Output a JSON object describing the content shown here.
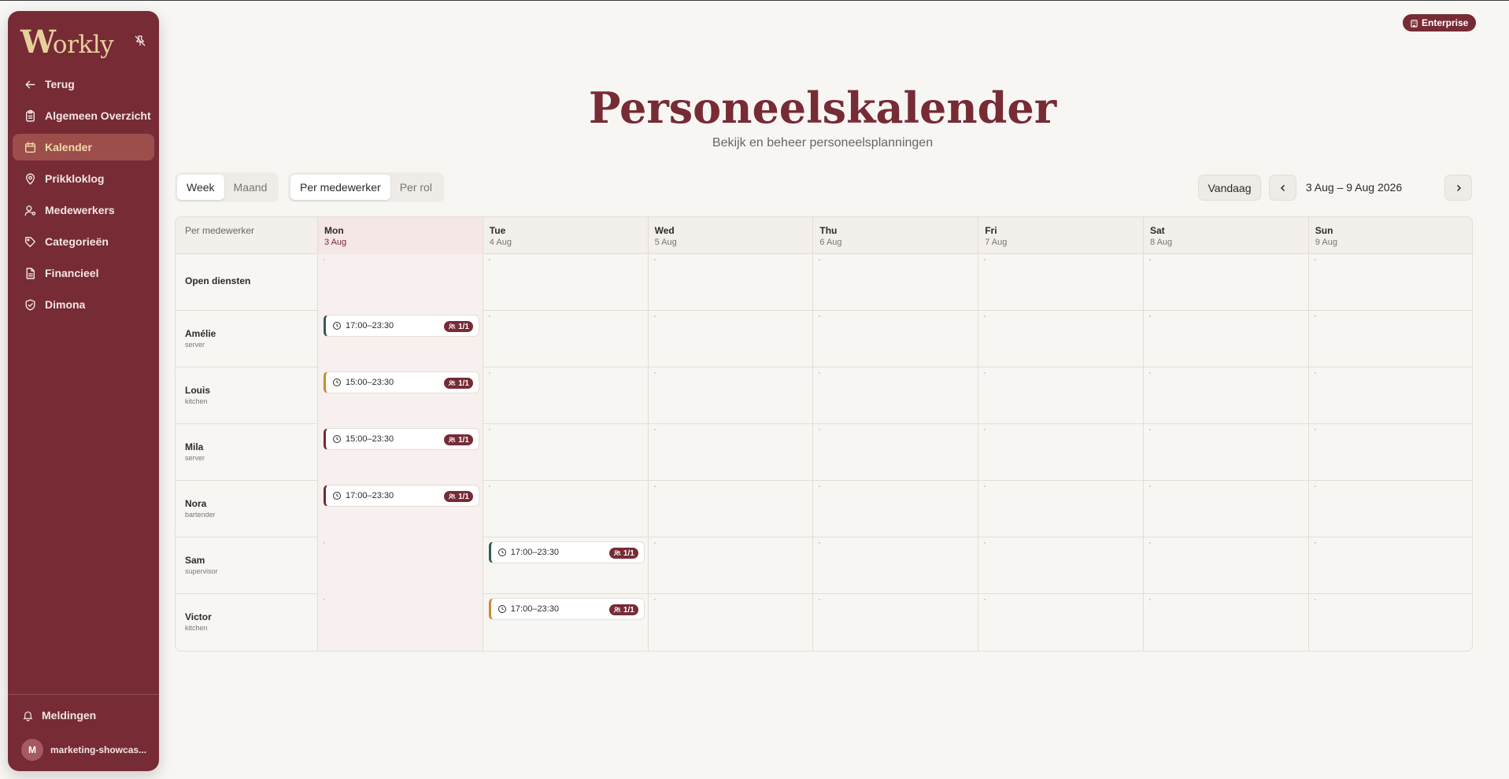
{
  "app": {
    "logo": "Workly",
    "logo_initial": "W",
    "logo_rest": "orkly",
    "plan_badge": "Enterprise"
  },
  "sidebar": {
    "items": [
      {
        "label": "Terug",
        "icon": "arrow-left-icon",
        "active": false
      },
      {
        "label": "Algemeen Overzicht",
        "icon": "clipboard-icon",
        "active": false
      },
      {
        "label": "Kalender",
        "icon": "calendar-icon",
        "active": true
      },
      {
        "label": "Prikkloklog",
        "icon": "map-pin-icon",
        "active": false
      },
      {
        "label": "Medewerkers",
        "icon": "user-gear-icon",
        "active": false
      },
      {
        "label": "Categorieën",
        "icon": "tag-icon",
        "active": false
      },
      {
        "label": "Financieel",
        "icon": "document-icon",
        "active": false
      },
      {
        "label": "Dimona",
        "icon": "shield-check-icon",
        "active": false
      }
    ],
    "notifications_label": "Meldingen",
    "user": {
      "initial": "M",
      "name": "marketing-showcas..."
    }
  },
  "header": {
    "title": "Personeelskalender",
    "subtitle": "Bekijk en beheer personeelsplanningen"
  },
  "toolbar": {
    "view_modes": [
      {
        "label": "Week",
        "selected": true
      },
      {
        "label": "Maand",
        "selected": false
      }
    ],
    "group_modes": [
      {
        "label": "Per medewerker",
        "selected": true
      },
      {
        "label": "Per rol",
        "selected": false
      }
    ],
    "today_label": "Vandaag",
    "date_range": "3 Aug – 9 Aug 2026"
  },
  "calendar": {
    "corner_label": "Per medewerker",
    "days": [
      {
        "day": "Mon",
        "date": "3 Aug",
        "today": true
      },
      {
        "day": "Tue",
        "date": "4 Aug",
        "today": false
      },
      {
        "day": "Wed",
        "date": "5 Aug",
        "today": false
      },
      {
        "day": "Thu",
        "date": "6 Aug",
        "today": false
      },
      {
        "day": "Fri",
        "date": "7 Aug",
        "today": false
      },
      {
        "day": "Sat",
        "date": "8 Aug",
        "today": false
      },
      {
        "day": "Sun",
        "date": "9 Aug",
        "today": false
      }
    ],
    "rows": [
      {
        "name": "Open diensten",
        "role": "",
        "shifts": []
      },
      {
        "name": "Amélie",
        "role": "server",
        "shifts": [
          {
            "day": 0,
            "time": "17:00–23:30",
            "badge": "1/1",
            "accent": "#2f5d50"
          }
        ]
      },
      {
        "name": "Louis",
        "role": "kitchen",
        "shifts": [
          {
            "day": 0,
            "time": "15:00–23:30",
            "badge": "1/1",
            "accent": "#c98a35"
          }
        ]
      },
      {
        "name": "Mila",
        "role": "server",
        "shifts": [
          {
            "day": 0,
            "time": "15:00–23:30",
            "badge": "1/1",
            "accent": "#762b35"
          }
        ]
      },
      {
        "name": "Nora",
        "role": "bartender",
        "shifts": [
          {
            "day": 0,
            "time": "17:00–23:30",
            "badge": "1/1",
            "accent": "#762b35"
          }
        ]
      },
      {
        "name": "Sam",
        "role": "supervisor",
        "shifts": [
          {
            "day": 1,
            "time": "17:00–23:30",
            "badge": "1/1",
            "accent": "#2f5d50"
          }
        ]
      },
      {
        "name": "Victor",
        "role": "kitchen",
        "shifts": [
          {
            "day": 1,
            "time": "17:00–23:30",
            "badge": "1/1",
            "accent": "#c98a35"
          }
        ]
      }
    ]
  },
  "colors": {
    "brand": "#762b35",
    "accent_gold": "#e7cf9c",
    "background": "#f8f6f3"
  }
}
